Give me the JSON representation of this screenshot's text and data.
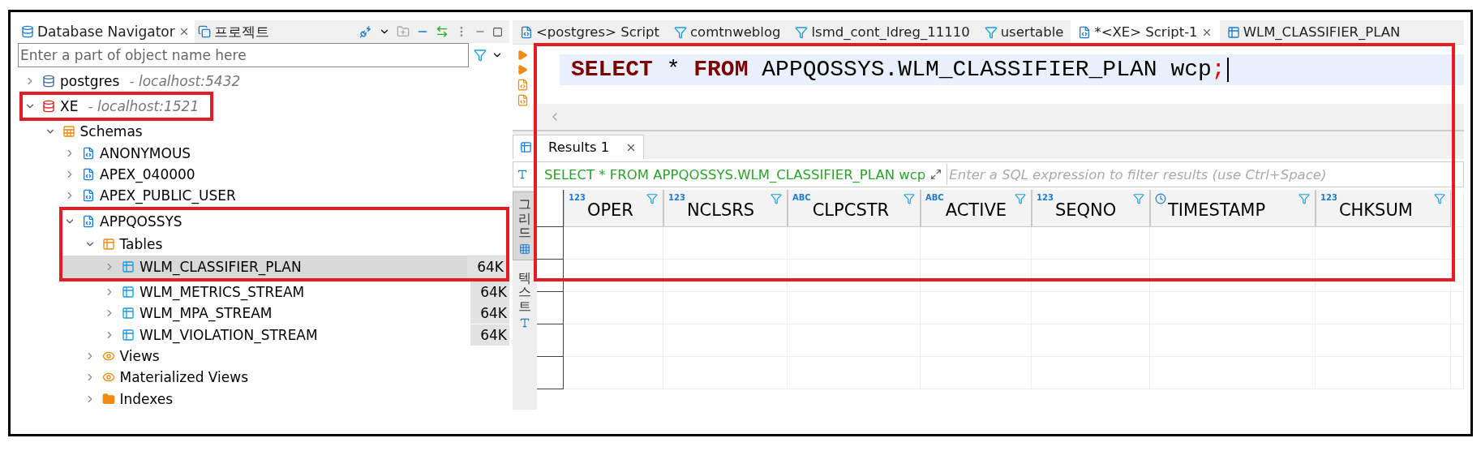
{
  "navigator": {
    "tabs": [
      {
        "label": "Database Navigator",
        "kind": "database",
        "selected": true,
        "closable": true
      },
      {
        "label": "프로젝트",
        "kind": "project",
        "selected": false,
        "closable": false
      }
    ],
    "filter": {
      "placeholder": "Enter a part of object name here"
    },
    "tree": [
      {
        "label": "postgres",
        "detail": "- localhost:5432",
        "kind": "pg",
        "expanded": false,
        "selected": false,
        "highlighted": false
      },
      {
        "label": "XE",
        "detail": "- localhost:1521",
        "kind": "oracle",
        "expanded": true,
        "selected": false,
        "highlighted": true,
        "children": [
          {
            "label": "Schemas",
            "kind": "schemas",
            "expanded": true,
            "selected": false,
            "highlighted": false,
            "children": [
              {
                "label": "ANONYMOUS",
                "kind": "schema",
                "expanded": false,
                "selected": false,
                "highlighted": false
              },
              {
                "label": "APEX_040000",
                "kind": "schema",
                "expanded": false,
                "selected": false,
                "highlighted": false
              },
              {
                "label": "APEX_PUBLIC_USER",
                "kind": "schema",
                "expanded": false,
                "selected": false,
                "highlighted": false
              },
              {
                "label": "APPQOSSYS",
                "kind": "schema",
                "expanded": true,
                "selected": false,
                "highlighted": true,
                "children": [
                  {
                    "label": "Tables",
                    "kind": "tables",
                    "expanded": true,
                    "selected": false,
                    "highlighted": true,
                    "children": [
                      {
                        "label": "WLM_CLASSIFIER_PLAN",
                        "kind": "table",
                        "size": "64K",
                        "expanded": false,
                        "selected": true,
                        "highlighted": true
                      },
                      {
                        "label": "WLM_METRICS_STREAM",
                        "kind": "table",
                        "size": "64K",
                        "expanded": false,
                        "selected": false,
                        "highlighted": false
                      },
                      {
                        "label": "WLM_MPA_STREAM",
                        "kind": "table",
                        "size": "64K",
                        "expanded": false,
                        "selected": false,
                        "highlighted": false
                      },
                      {
                        "label": "WLM_VIOLATION_STREAM",
                        "kind": "table",
                        "size": "64K",
                        "expanded": false,
                        "selected": false,
                        "highlighted": false
                      }
                    ]
                  },
                  {
                    "label": "Views",
                    "kind": "views",
                    "expanded": false,
                    "selected": false,
                    "highlighted": false
                  },
                  {
                    "label": "Materialized Views",
                    "kind": "views",
                    "expanded": false,
                    "selected": false,
                    "highlighted": false
                  },
                  {
                    "label": "Indexes",
                    "kind": "folder",
                    "expanded": false,
                    "selected": false,
                    "highlighted": false
                  }
                ]
              }
            ]
          }
        ]
      }
    ]
  },
  "editor": {
    "tabs": [
      {
        "label": "<postgres> Script",
        "kind": "script",
        "selected": false
      },
      {
        "label": "comtnweblog",
        "kind": "sql",
        "selected": false
      },
      {
        "label": "lsmd_cont_ldreg_11110",
        "kind": "sql",
        "selected": false
      },
      {
        "label": "usertable",
        "kind": "sql",
        "selected": false
      },
      {
        "label": "*<XE> Script-1",
        "kind": "script",
        "selected": true
      },
      {
        "label": "WLM_CLASSIFIER_PLAN",
        "kind": "table",
        "selected": false
      }
    ],
    "code": [
      {
        "text": "SELECT",
        "kind": "keyword"
      },
      {
        "text": "*",
        "kind": "plain"
      },
      {
        "text": "FROM",
        "kind": "keyword"
      },
      {
        "text": "APPQOSSYS.WLM_CLASSIFIER_PLAN",
        "kind": "plain"
      },
      {
        "text": "wcp",
        "kind": "plain"
      },
      {
        "text": ";",
        "kind": "punct"
      }
    ],
    "highlighted": true
  },
  "results": {
    "tab": {
      "label": "Results 1",
      "selected": true
    },
    "query": "SELECT * FROM APPQOSSYS.WLM_CLASSIFIER_PLAN wcp",
    "filter": {
      "placeholder": "Enter a SQL expression to filter results (use Ctrl+Space)"
    },
    "side_tabs": [
      {
        "label": "그리드",
        "kind": "grid",
        "selected": true
      },
      {
        "label": "텍스트",
        "kind": "text",
        "selected": false
      }
    ],
    "columns": [
      {
        "name": "OPER",
        "type": "123",
        "kind": "number"
      },
      {
        "name": "NCLSRS",
        "type": "123",
        "kind": "number"
      },
      {
        "name": "CLPCSTR",
        "type": "ABC",
        "kind": "string"
      },
      {
        "name": "ACTIVE",
        "type": "ABC",
        "kind": "string"
      },
      {
        "name": "SEQNO",
        "type": "123",
        "kind": "number"
      },
      {
        "name": "TIMESTAMP",
        "kind": "datetime"
      },
      {
        "name": "CHKSUM",
        "type": "123",
        "kind": "number"
      }
    ]
  }
}
